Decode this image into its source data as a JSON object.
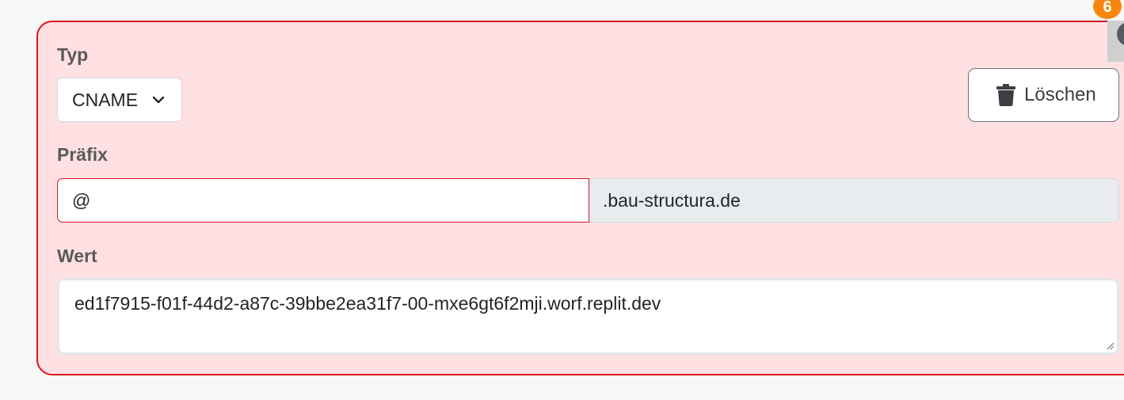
{
  "form": {
    "type_label": "Typ",
    "type_value": "CNAME",
    "prefix_label": "Präfix",
    "prefix_value": "@",
    "domain_suffix": ".bau-structura.de",
    "value_label": "Wert",
    "value_text": "ed1f7915-f01f-44d2-a87c-39bbe2ea31f7-00-mxe6gt6f2mji.worf.replit.dev"
  },
  "actions": {
    "delete_label": "Löschen"
  },
  "notification": {
    "count": "6"
  },
  "colors": {
    "card_background": "#ffe0e3",
    "card_border": "#d9151f",
    "addon_background": "#e9ecef",
    "badge": "#f7860e"
  },
  "icons": {
    "delete": "trash-icon",
    "select": "chevron-down-icon",
    "resize": "resize-grip-icon"
  }
}
